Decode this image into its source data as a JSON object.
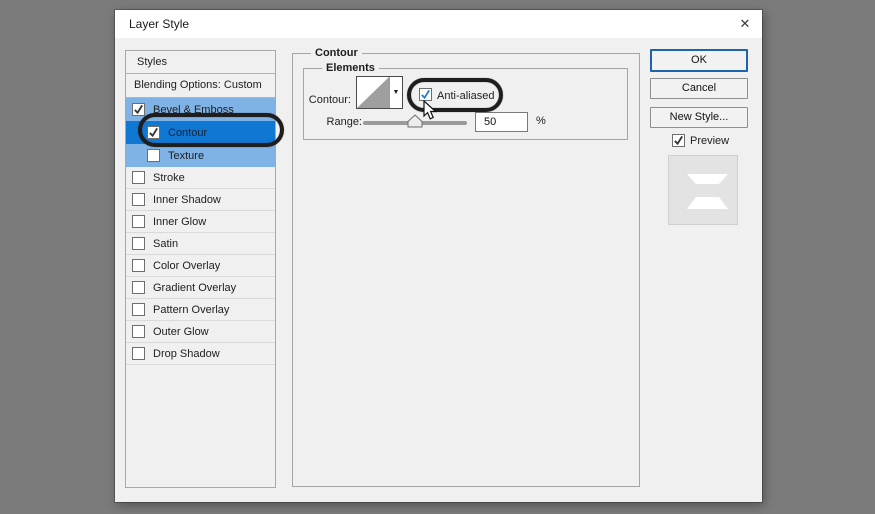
{
  "window": {
    "title": "Layer Style",
    "close_glyph": "✕"
  },
  "styles_panel": {
    "header": "Styles",
    "blending_row": "Blending Options: Custom",
    "items": [
      {
        "label": "Bevel & Emboss",
        "checked": true,
        "state": "light",
        "indent": false
      },
      {
        "label": "Contour",
        "checked": true,
        "state": "selected",
        "indent": true
      },
      {
        "label": "Texture",
        "checked": false,
        "state": "light",
        "indent": true
      },
      {
        "label": "Stroke",
        "checked": false,
        "state": "plain",
        "indent": false
      },
      {
        "label": "Inner Shadow",
        "checked": false,
        "state": "plain",
        "indent": false
      },
      {
        "label": "Inner Glow",
        "checked": false,
        "state": "plain",
        "indent": false
      },
      {
        "label": "Satin",
        "checked": false,
        "state": "plain",
        "indent": false
      },
      {
        "label": "Color Overlay",
        "checked": false,
        "state": "plain",
        "indent": false
      },
      {
        "label": "Gradient Overlay",
        "checked": false,
        "state": "plain",
        "indent": false
      },
      {
        "label": "Pattern Overlay",
        "checked": false,
        "state": "plain",
        "indent": false
      },
      {
        "label": "Outer Glow",
        "checked": false,
        "state": "plain",
        "indent": false
      },
      {
        "label": "Drop Shadow",
        "checked": false,
        "state": "plain",
        "indent": false
      }
    ]
  },
  "contour_section": {
    "group_label": "Contour",
    "elements_label": "Elements",
    "contour_label": "Contour:",
    "dropdown_glyph": "▼",
    "anti_aliased_label": "Anti-aliased",
    "anti_aliased_checked": true,
    "range_label": "Range:",
    "range_value": "50",
    "range_unit": "%",
    "range_percent": 50
  },
  "actions": {
    "ok_label": "OK",
    "cancel_label": "Cancel",
    "new_style_label": "New Style...",
    "preview_label": "Preview",
    "preview_checked": true
  },
  "colors": {
    "backdrop": "#7b7b7b",
    "dialog_bg": "#f0f0f0",
    "titlebar_bg": "#ffffff",
    "row_light_blue": "#7fb2e5",
    "row_selected_blue": "#1077d2",
    "ok_border": "#1f63ad",
    "check_dark": "#333333",
    "check_blue": "#2a7fc9",
    "annotation": "#1e1e1e",
    "group_border": "#a5a5a5",
    "slider_track": "#9a9a9a",
    "thumb_gray": "#9f9f9f",
    "preview_bg": "#e3e3e3"
  }
}
